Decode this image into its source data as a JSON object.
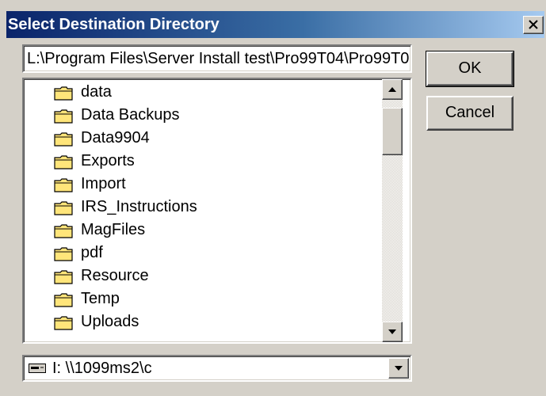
{
  "window": {
    "title": "Select Destination Directory",
    "close_icon": "close-icon"
  },
  "path_field": {
    "value": "L:\\Program Files\\Server Install test\\Pro99T04\\Pro99T0"
  },
  "buttons": {
    "ok_label": "OK",
    "cancel_label": "Cancel"
  },
  "folders": [
    {
      "label": "data",
      "icon": "folder-icon"
    },
    {
      "label": "Data Backups",
      "icon": "folder-icon"
    },
    {
      "label": "Data9904",
      "icon": "folder-icon"
    },
    {
      "label": "Exports",
      "icon": "folder-icon"
    },
    {
      "label": "Import",
      "icon": "folder-icon"
    },
    {
      "label": "IRS_Instructions",
      "icon": "folder-icon"
    },
    {
      "label": "MagFiles",
      "icon": "folder-icon"
    },
    {
      "label": "pdf",
      "icon": "folder-icon"
    },
    {
      "label": "Resource",
      "icon": "folder-icon"
    },
    {
      "label": "Temp",
      "icon": "folder-icon"
    },
    {
      "label": "Uploads",
      "icon": "folder-icon"
    }
  ],
  "drive": {
    "selected": "I:  \\\\1099ms2\\c",
    "icon": "network-drive-icon"
  },
  "colors": {
    "titlebar_start": "#0a246a",
    "titlebar_end": "#a6caf0",
    "face": "#d4d0c8",
    "folder": "#ffe57a"
  }
}
